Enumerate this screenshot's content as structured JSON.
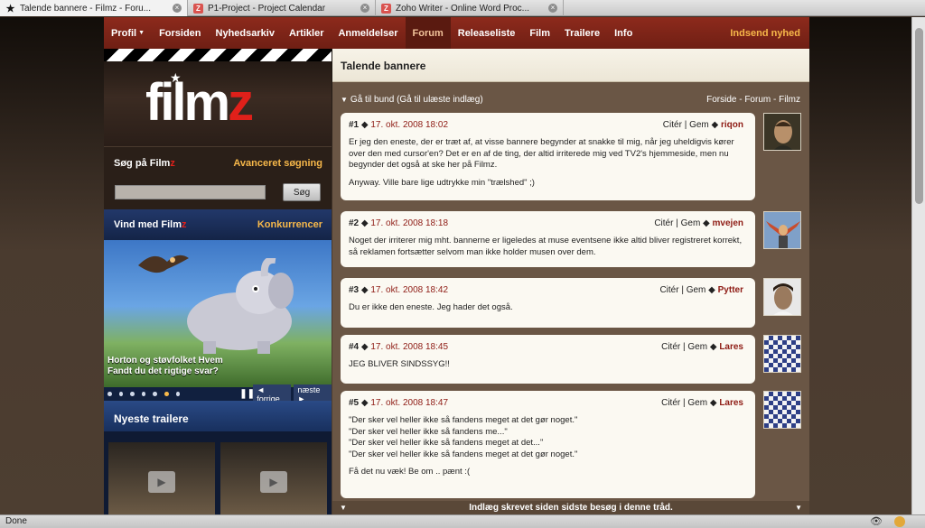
{
  "browser": {
    "tabs": [
      {
        "title": "Talende bannere - Filmz - Foru...",
        "icon": "star-icon",
        "active": true
      },
      {
        "title": "P1-Project - Project Calendar",
        "icon": "zoho-icon",
        "active": false
      },
      {
        "title": "Zoho Writer - Online Word Proc...",
        "icon": "zoho-icon",
        "active": false
      }
    ],
    "status": "Done"
  },
  "nav": {
    "items": [
      "Profil",
      "Forsiden",
      "Nyhedsarkiv",
      "Artikler",
      "Anmeldelser",
      "Forum",
      "Releaseliste",
      "Film",
      "Trailere",
      "Info"
    ],
    "active": "Forum",
    "submit": "Indsend nyhed"
  },
  "logo": {
    "main": "film",
    "accent": "z"
  },
  "search": {
    "title_main": "Søg på Film",
    "title_accent": "z",
    "advanced": "Avanceret søgning",
    "button": "Søg",
    "value": ""
  },
  "contest": {
    "title_main": "Vind med Film",
    "title_accent": "z",
    "link": "Konkurrencer",
    "caption_line1": "Horton og støvfolket Hvem",
    "caption_line2": "Fandt du det rigtige svar?",
    "prev": "◄ forrige",
    "next": "næste ►",
    "dots": 7,
    "active_dot": 5
  },
  "trailers": {
    "title": "Nyeste trailere"
  },
  "thread": {
    "title": "Talende bannere",
    "nav_bottom": "Gå til bund",
    "nav_unread": "(Gå til ulæste indlæg)",
    "breadcrumb": "Forside - Forum - Filmz",
    "bottom_bar": "Indlæg skrevet siden sidste besøg i denne tråd.",
    "actions": {
      "quote": "Citér",
      "save": "Gem"
    }
  },
  "posts": [
    {
      "num": "#1",
      "date": "17. okt. 2008 18:02",
      "author": "riqon",
      "paragraphs": [
        "Er jeg den eneste, der er træt af, at visse bannere begynder at snakke til mig, når jeg uheldigvis kører over den med cursor'en? Det er en af de ting, der altid irriterede mig ved TV2's hjemmeside, men nu begynder det også at ske her på Filmz.",
        "Anyway. Ville bare lige udtrykke min \"trælshed\" ;)"
      ]
    },
    {
      "num": "#2",
      "date": "17. okt. 2008 18:18",
      "author": "mvejen",
      "paragraphs": [
        "Noget der irriterer mig mht. bannerne er ligeledes at muse eventsene ikke altid bliver registreret korrekt, så reklamen fortsætter selvom man ikke holder musen over dem."
      ]
    },
    {
      "num": "#3",
      "date": "17. okt. 2008 18:42",
      "author": "Pytter",
      "paragraphs": [
        "Du er ikke den eneste. Jeg hader det også."
      ]
    },
    {
      "num": "#4",
      "date": "17. okt. 2008 18:45",
      "author": "Lares",
      "paragraphs": [
        "JEG BLIVER SINDSSYG!!"
      ]
    },
    {
      "num": "#5",
      "date": "17. okt. 2008 18:47",
      "author": "Lares",
      "lines": [
        "\"Der sker vel heller ikke så fandens meget at det gør noget.\"",
        "\"Der sker vel heller ikke så fandens me...\"",
        "\"Der sker vel heller ikke så fandens meget at det...\"",
        "\"Der sker vel heller ikke så fandens meget at det gør noget.\""
      ],
      "paragraphs": [
        "Få det nu væk! Be om .. pænt :("
      ]
    }
  ],
  "colors": {
    "nav_bg": "#7a2418",
    "accent_yellow": "#f7b84a",
    "date_red": "#8e1b14",
    "logo_z": "#e0201a"
  }
}
